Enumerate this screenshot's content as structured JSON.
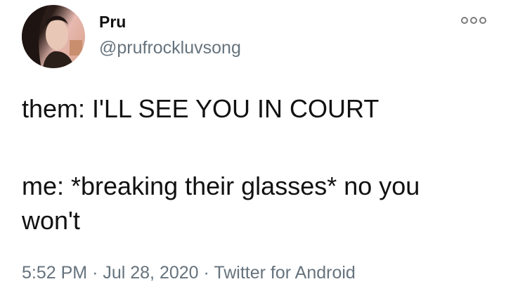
{
  "tweet": {
    "author_name": "Pru",
    "author_handle": "@prufrockluvsong",
    "menu_icon": "more-options-icon",
    "lines": [
      "them: I'LL SEE YOU IN COURT",
      "me: *breaking their glasses* no you",
      "won't"
    ],
    "time": "5:52 PM",
    "date": "Jul 28, 2020",
    "source": "Twitter for Android",
    "separator": "·"
  }
}
